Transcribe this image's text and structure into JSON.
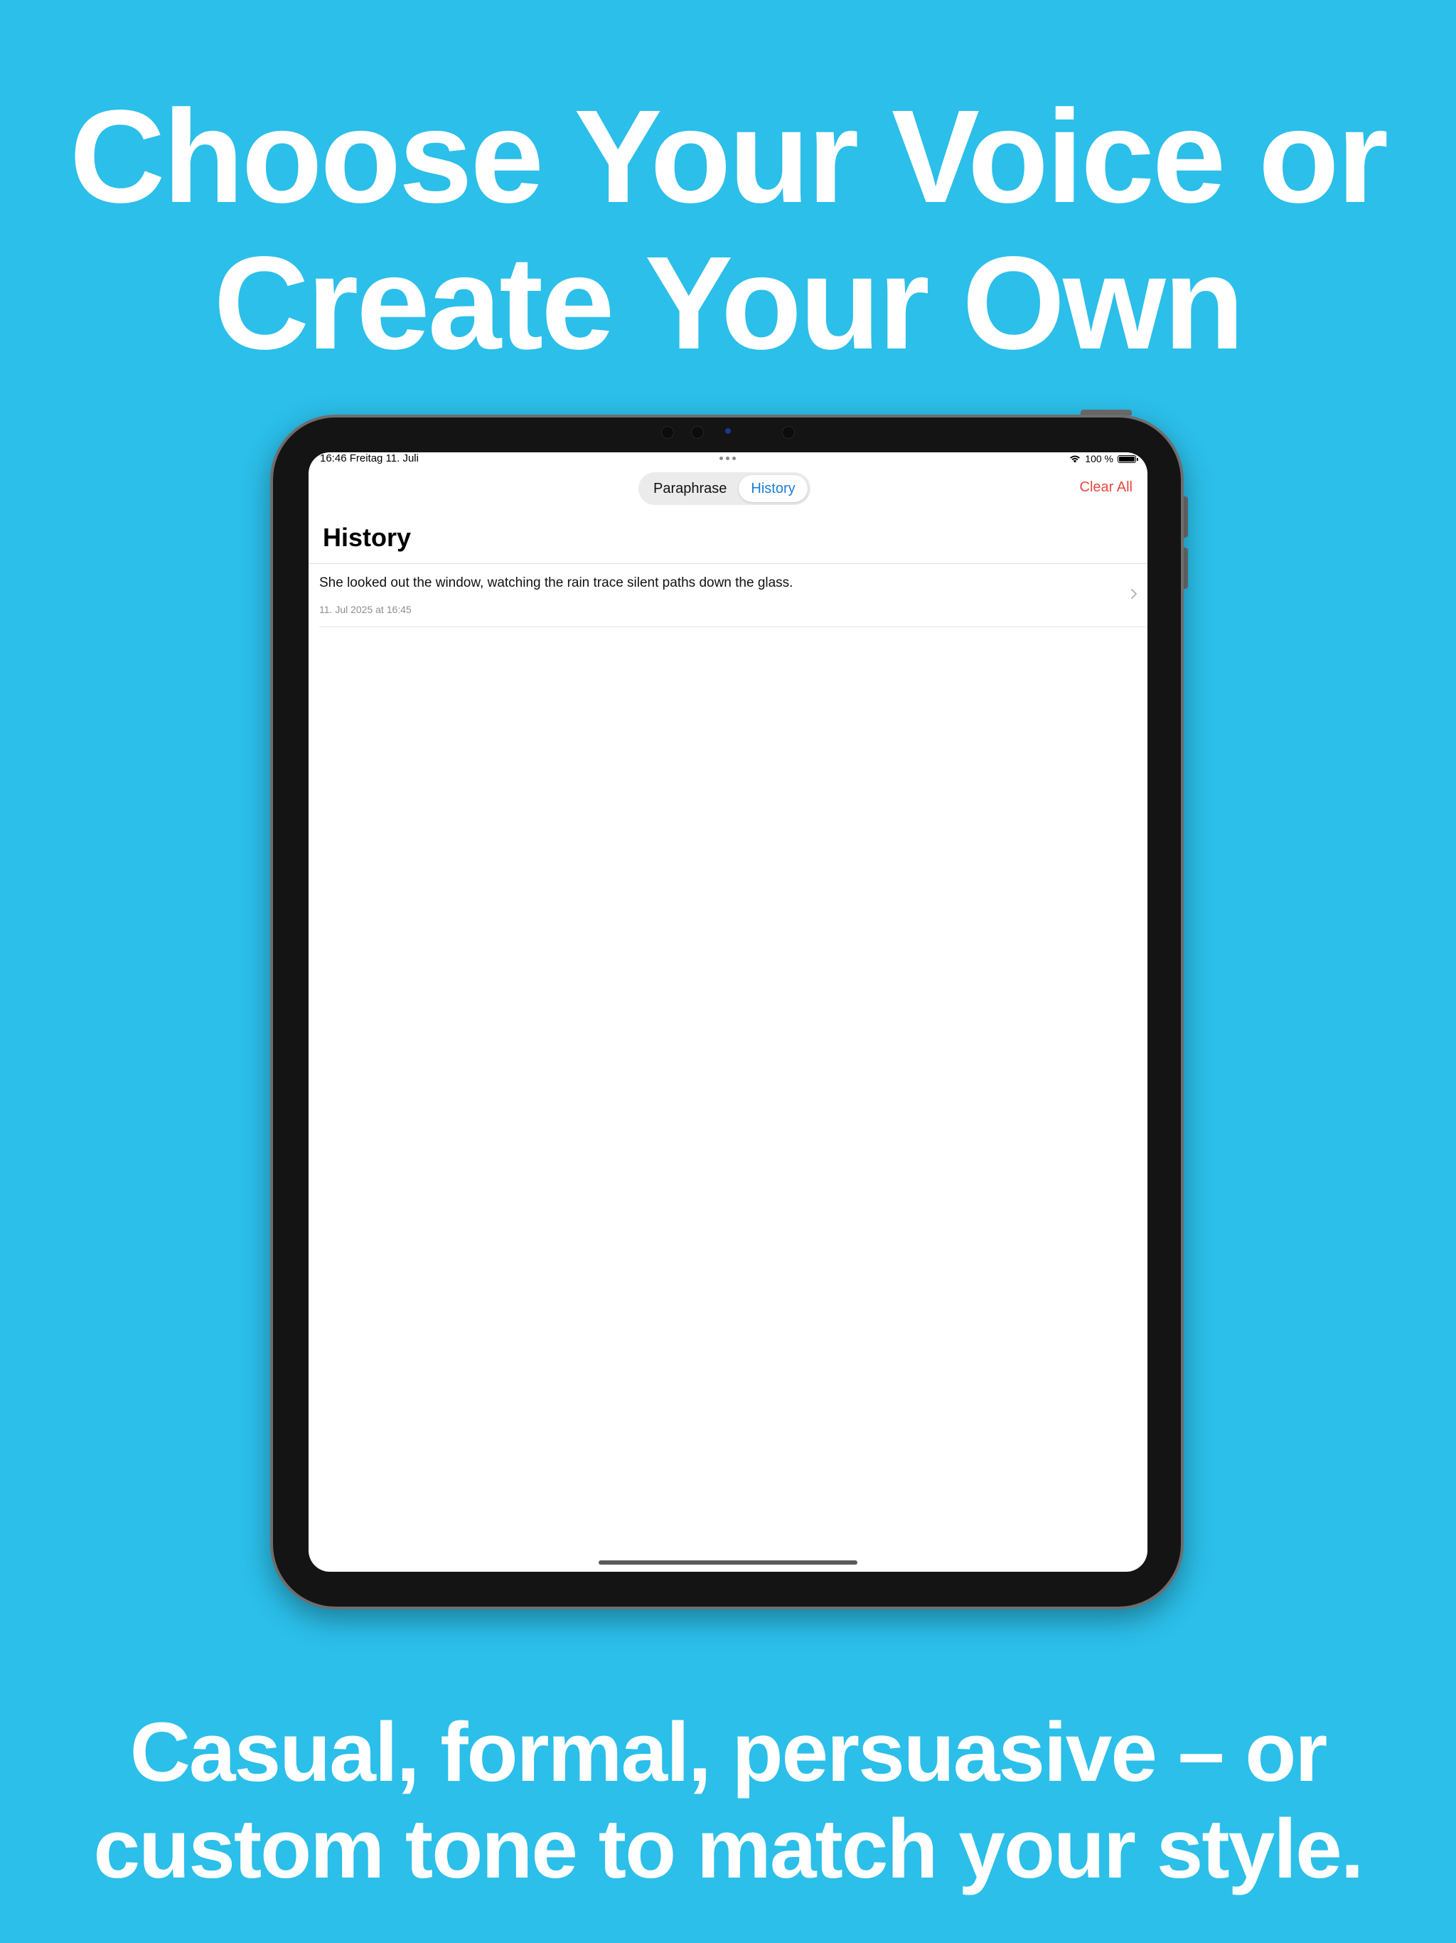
{
  "headline": {
    "line1": "Choose Your Voice or",
    "line2": "Create Your Own"
  },
  "subline": {
    "line1": "Casual, formal, persuasive – or",
    "line2": "custom tone to match your style."
  },
  "status_bar": {
    "time_date": "16:46   Freitag 11. Juli",
    "battery_text": "100 %",
    "battery_level": 1.0
  },
  "tabs": [
    {
      "label": "Paraphrase",
      "active": false
    },
    {
      "label": "History",
      "active": true
    }
  ],
  "toolbar": {
    "clear_all_label": "Clear All"
  },
  "page_title": "History",
  "history": [
    {
      "text": "She looked out the window, watching the rain trace silent paths down the glass.",
      "date": "11. Jul 2025 at 16:45"
    }
  ],
  "colors": {
    "background": "#2bbfe9",
    "accent": "#1c7cd6",
    "destructive": "#e8463c"
  }
}
